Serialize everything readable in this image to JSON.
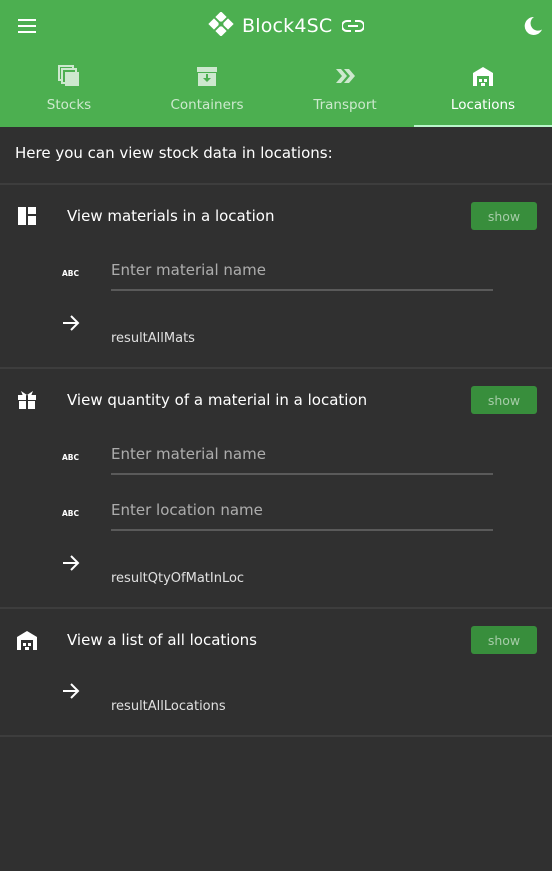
{
  "header": {
    "title": "Block4SC",
    "menu_icon": "menu-icon",
    "logo_icon": "block-logo-icon",
    "link_icon": "link-icon",
    "theme_icon": "dark-mode-icon",
    "color": "#4caf50"
  },
  "tabs": [
    {
      "label": "Stocks",
      "icon": "stack-icon",
      "active": false
    },
    {
      "label": "Containers",
      "icon": "archive-box-icon",
      "active": false
    },
    {
      "label": "Transport",
      "icon": "double-chevron-icon",
      "active": false
    },
    {
      "label": "Locations",
      "icon": "warehouse-icon",
      "active": true
    }
  ],
  "intro": "Here you can view stock data in locations:",
  "sections": [
    {
      "title": "View materials in a location",
      "icon": "dashboard-icon",
      "show_label": "show",
      "fields": [
        {
          "placeholder": "Enter material name",
          "value": ""
        }
      ],
      "result": "resultAllMats"
    },
    {
      "title": "View quantity of a material in a location",
      "icon": "gift-box-icon",
      "show_label": "show",
      "fields": [
        {
          "placeholder": "Enter material name",
          "value": ""
        },
        {
          "placeholder": "Enter location name",
          "value": ""
        }
      ],
      "result": "resultQtyOfMatInLoc"
    },
    {
      "title": "View a list of all locations",
      "icon": "warehouse-icon",
      "show_label": "show",
      "fields": [],
      "result": "resultAllLocations"
    }
  ]
}
